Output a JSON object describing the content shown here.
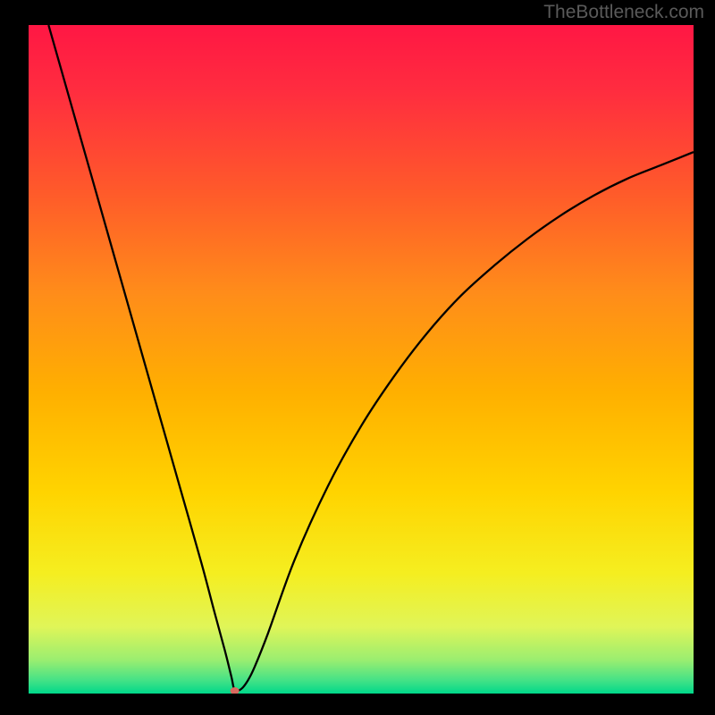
{
  "watermark": "TheBottleneck.com",
  "chart_data": {
    "type": "line",
    "title": "",
    "xlabel": "",
    "ylabel": "",
    "xlim": [
      0,
      100
    ],
    "ylim": [
      0,
      100
    ],
    "grid": false,
    "legend": false,
    "x": [
      3,
      5,
      8,
      11,
      14,
      17,
      20,
      23,
      26,
      28,
      29.5,
      30.5,
      31,
      32,
      33,
      34,
      36,
      40,
      45,
      50,
      55,
      60,
      65,
      70,
      75,
      80,
      85,
      90,
      95,
      100
    ],
    "y": [
      100,
      93,
      82.5,
      72,
      61.5,
      51,
      40.5,
      30,
      19.5,
      12,
      6.5,
      2.5,
      0.5,
      0.7,
      2,
      4,
      9,
      20,
      31,
      40,
      47.5,
      54,
      59.5,
      64,
      68,
      71.5,
      74.5,
      77,
      79,
      81
    ],
    "background_gradient": {
      "stops": [
        {
          "pos": 0.0,
          "color": "#ff1744"
        },
        {
          "pos": 0.1,
          "color": "#ff2d3f"
        },
        {
          "pos": 0.25,
          "color": "#ff5a2a"
        },
        {
          "pos": 0.4,
          "color": "#ff8c1a"
        },
        {
          "pos": 0.55,
          "color": "#ffb000"
        },
        {
          "pos": 0.7,
          "color": "#ffd400"
        },
        {
          "pos": 0.82,
          "color": "#f5ee20"
        },
        {
          "pos": 0.9,
          "color": "#e0f558"
        },
        {
          "pos": 0.95,
          "color": "#9aee70"
        },
        {
          "pos": 0.98,
          "color": "#45e286"
        },
        {
          "pos": 1.0,
          "color": "#00d88a"
        }
      ]
    },
    "marker": {
      "x": 31,
      "y": 0.4,
      "color": "#d9695f",
      "rx": 5,
      "ry": 4
    },
    "curve_color": "#000000",
    "curve_width": 2.3
  }
}
